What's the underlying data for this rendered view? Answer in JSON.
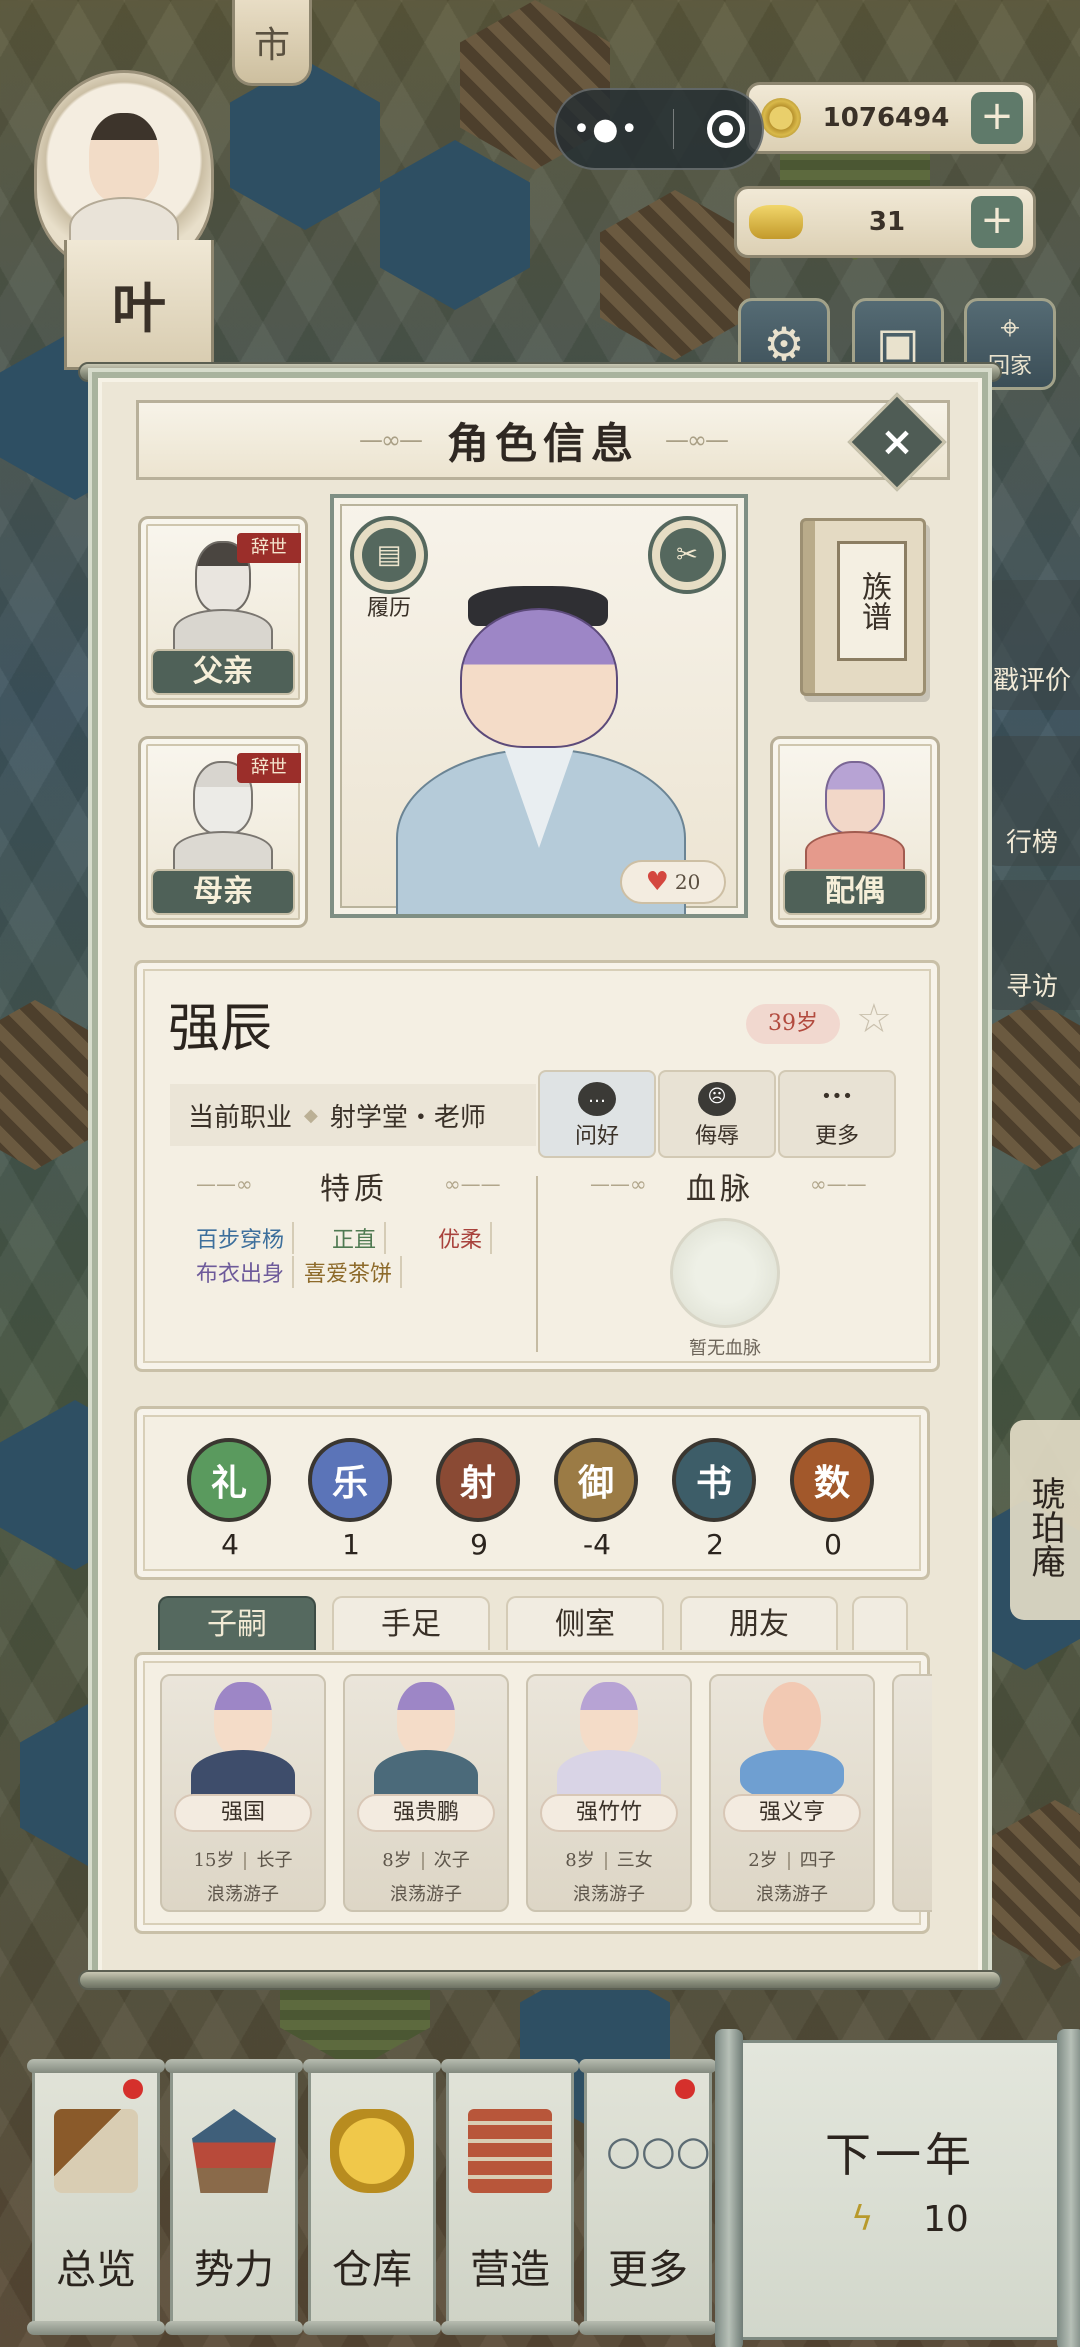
{
  "hud": {
    "copper_coins": "1076494",
    "gold_ingots": "31",
    "plus": "+",
    "player_initial": "叶",
    "coin_tab_char": "市",
    "home_label": "回家",
    "side_labels": [
      "戳评价",
      "行榜",
      "寻访",
      "琥珀庵"
    ]
  },
  "dialog": {
    "title": "角色信息",
    "close": "×",
    "father_label": "父亲",
    "mother_label": "母亲",
    "spouse_label": "配偶",
    "deceased_tag": "辞世",
    "resume_label": "履历",
    "genealogy_label": "族谱",
    "affection_value": "20"
  },
  "character": {
    "name": "强辰",
    "age": "39岁",
    "job_prefix": "当前职业",
    "job": "射学堂・老师",
    "actions": [
      {
        "label": "问好",
        "icon": "…"
      },
      {
        "label": "侮辱",
        "icon": "☹"
      },
      {
        "label": "更多",
        "icon": "•••"
      }
    ],
    "traits_title": "特质",
    "bloodline_title": "血脉",
    "traits": [
      {
        "text": "百步穿杨",
        "color": "#3d6f9c"
      },
      {
        "text": "正直",
        "color": "#4f7a52"
      },
      {
        "text": "优柔",
        "color": "#a8423c"
      },
      {
        "text": "布衣出身",
        "color": "#6d5a9a"
      },
      {
        "text": "喜爱茶饼",
        "color": "#8d6a2a"
      }
    ],
    "no_bloodline": "暂无血脉"
  },
  "stats": [
    {
      "name": "礼",
      "value": "4",
      "color": "#5a9a5e"
    },
    {
      "name": "乐",
      "value": "1",
      "color": "#5b74b8"
    },
    {
      "name": "射",
      "value": "9",
      "color": "#8a4a34"
    },
    {
      "name": "御",
      "value": "-4",
      "color": "#9b7b45"
    },
    {
      "name": "书",
      "value": "2",
      "color": "#3d5d68"
    },
    {
      "name": "数",
      "value": "0",
      "color": "#a2582b"
    }
  ],
  "tabs": [
    "子嗣",
    "手足",
    "侧室",
    "朋友"
  ],
  "children": [
    {
      "name": "强国",
      "age": "15岁",
      "rank": "长子",
      "status": "浪荡游子"
    },
    {
      "name": "强贵鹏",
      "age": "8岁",
      "rank": "次子",
      "status": "浪荡游子"
    },
    {
      "name": "强竹竹",
      "age": "8岁",
      "rank": "三女",
      "status": "浪荡游子"
    },
    {
      "name": "强义亨",
      "age": "2岁",
      "rank": "四子",
      "status": "浪荡游子"
    }
  ],
  "bottom_nav": [
    "总览",
    "势力",
    "仓库",
    "营造",
    "更多"
  ],
  "next_year": {
    "label": "下一年",
    "energy": "10"
  }
}
